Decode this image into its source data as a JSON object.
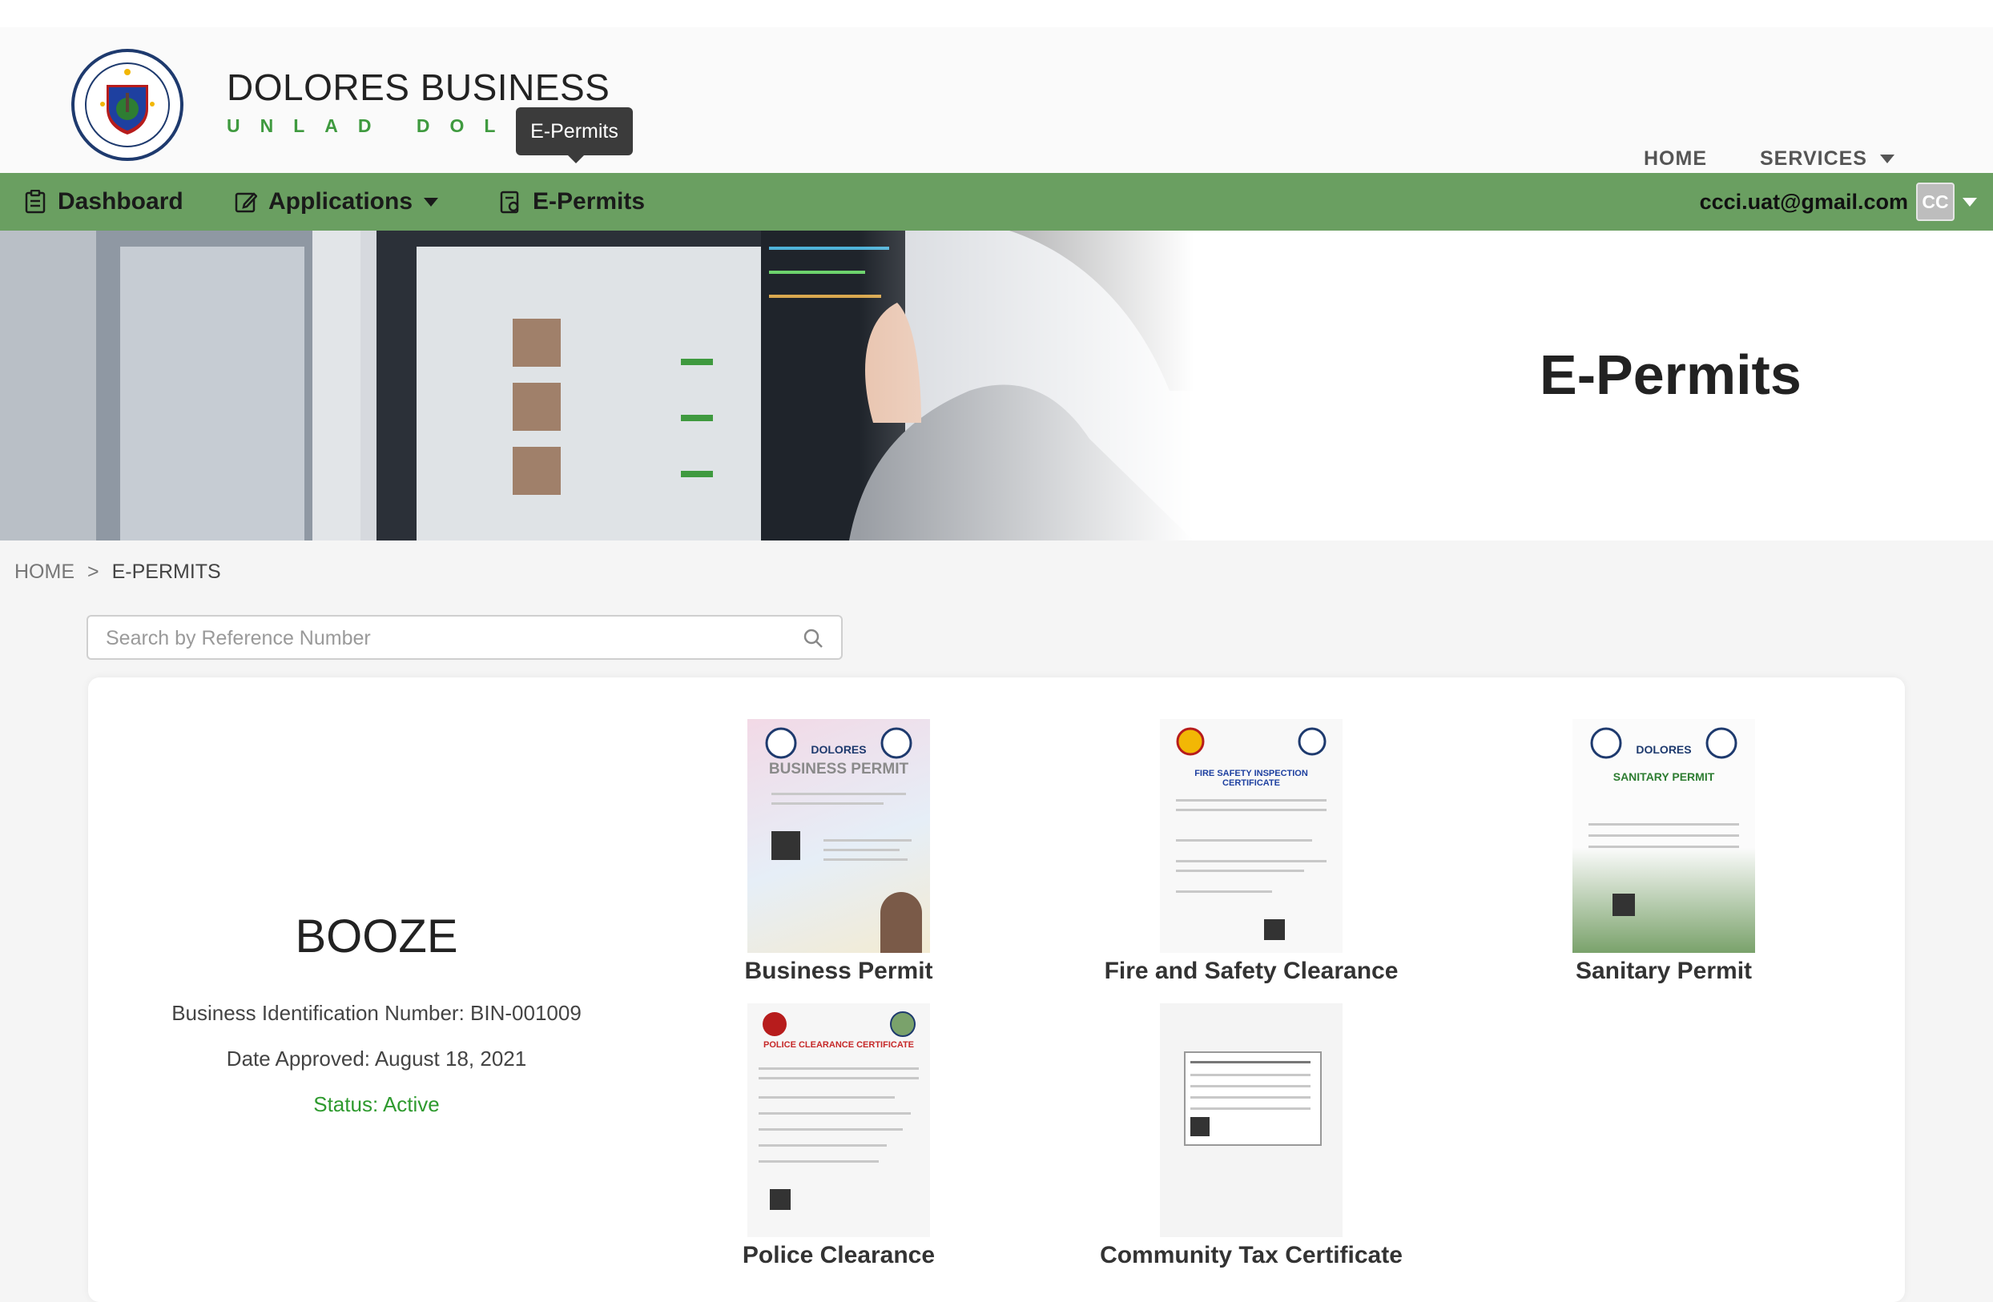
{
  "header": {
    "brand_title": "DOLORES BUSINESS",
    "brand_subtitle": "UNLAD DOLORES",
    "seal_text_top": "BAYAN NG DOLORES",
    "seal_text_bottom": "QUEZON",
    "tooltip": "E-Permits",
    "nav": {
      "home": "HOME",
      "services": "SERVICES"
    }
  },
  "subnav": {
    "dashboard": "Dashboard",
    "applications": "Applications",
    "epermits": "E-Permits",
    "user_email": "ccci.uat@gmail.com",
    "avatar_initials": "CC"
  },
  "hero": {
    "title": "E-Permits"
  },
  "breadcrumb": {
    "home": "HOME",
    "separator": ">",
    "current": "E-PERMITS"
  },
  "search": {
    "placeholder": "Search by Reference Number",
    "value": ""
  },
  "business": {
    "name": "BOOZE",
    "bin": "Business Identification Number: BIN-001009",
    "date_approved": "Date Approved: August 18, 2021",
    "status": "Status: Active"
  },
  "permits": [
    {
      "label": "Business Permit",
      "doc_title": "BUSINESS PERMIT",
      "doc_header": "DOLORES"
    },
    {
      "label": "Fire and Safety Clearance",
      "doc_title": "FIRE SAFETY INSPECTION CERTIFICATE"
    },
    {
      "label": "Sanitary Permit",
      "doc_title": "SANITARY PERMIT",
      "doc_header": "DOLORES"
    },
    {
      "label": "Police Clearance",
      "doc_title": "POLICE CLEARANCE CERTIFICATE"
    },
    {
      "label": "Community Tax Certificate"
    }
  ],
  "colors": {
    "nav_green": "#6a9f61",
    "status_green": "#2e9a2e",
    "brand_sub_green": "#3f9a3f"
  }
}
